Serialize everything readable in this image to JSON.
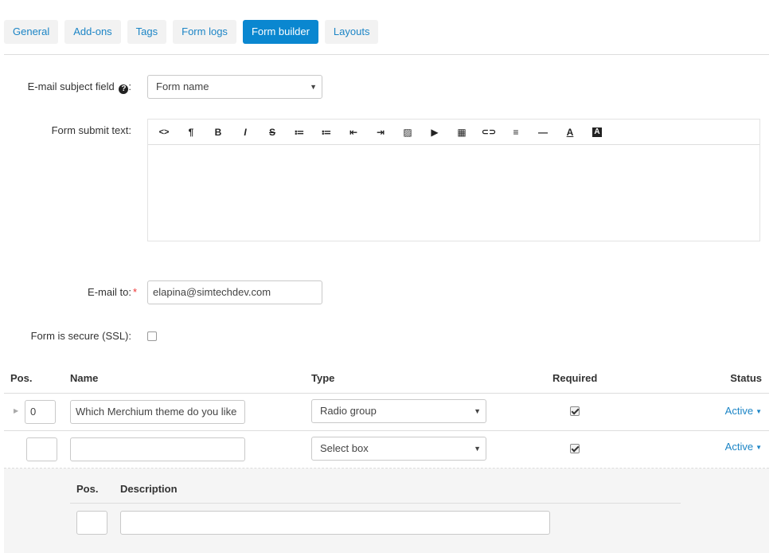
{
  "tabs": [
    {
      "label": "General"
    },
    {
      "label": "Add-ons"
    },
    {
      "label": "Tags"
    },
    {
      "label": "Form logs"
    },
    {
      "label": "Form builder",
      "active": true
    },
    {
      "label": "Layouts"
    }
  ],
  "form": {
    "email_subject": {
      "label": "E-mail subject field",
      "suffix": ":",
      "value": "Form name"
    },
    "submit_text": {
      "label": "Form submit text:"
    },
    "email_to": {
      "label": "E-mail to:",
      "required_mark": "*",
      "value": "elapina@simtechdev.com"
    },
    "ssl": {
      "label": "Form is secure (SSL):",
      "checked": false
    }
  },
  "editor_toolbar": [
    {
      "name": "html-code-icon",
      "glyph": "<>"
    },
    {
      "name": "paragraph-icon",
      "glyph": "¶"
    },
    {
      "name": "bold-icon",
      "glyph": "B"
    },
    {
      "name": "italic-icon",
      "glyph": "I"
    },
    {
      "name": "strikethrough-icon",
      "glyph": "S"
    },
    {
      "name": "unordered-list-icon",
      "glyph": "≔"
    },
    {
      "name": "ordered-list-icon",
      "glyph": "≔"
    },
    {
      "name": "outdent-icon",
      "glyph": "⇤"
    },
    {
      "name": "indent-icon",
      "glyph": "⇥"
    },
    {
      "name": "image-icon",
      "glyph": "▨"
    },
    {
      "name": "video-icon",
      "glyph": "▶"
    },
    {
      "name": "table-icon",
      "glyph": "▦"
    },
    {
      "name": "link-icon",
      "glyph": "⊂⊃"
    },
    {
      "name": "align-icon",
      "glyph": "≡"
    },
    {
      "name": "horizontal-rule-icon",
      "glyph": "—"
    },
    {
      "name": "font-color-icon",
      "glyph": "A"
    },
    {
      "name": "background-color-icon",
      "glyph": "A"
    }
  ],
  "table": {
    "headers": {
      "pos": "Pos.",
      "name": "Name",
      "type": "Type",
      "required": "Required",
      "status": "Status"
    },
    "rows": [
      {
        "pos": "0",
        "name": "Which Merchium theme do you like",
        "type": "Radio group",
        "required": true,
        "status": "Active"
      },
      {
        "pos": "",
        "name": "",
        "type": "Select box",
        "required": true,
        "status": "Active"
      }
    ]
  },
  "variants": {
    "headers": {
      "pos": "Pos.",
      "description": "Description"
    },
    "row": {
      "pos": "",
      "description": ""
    }
  },
  "colors": {
    "accent": "#0a87d0",
    "link": "#1c85c6",
    "required": "#e33"
  }
}
